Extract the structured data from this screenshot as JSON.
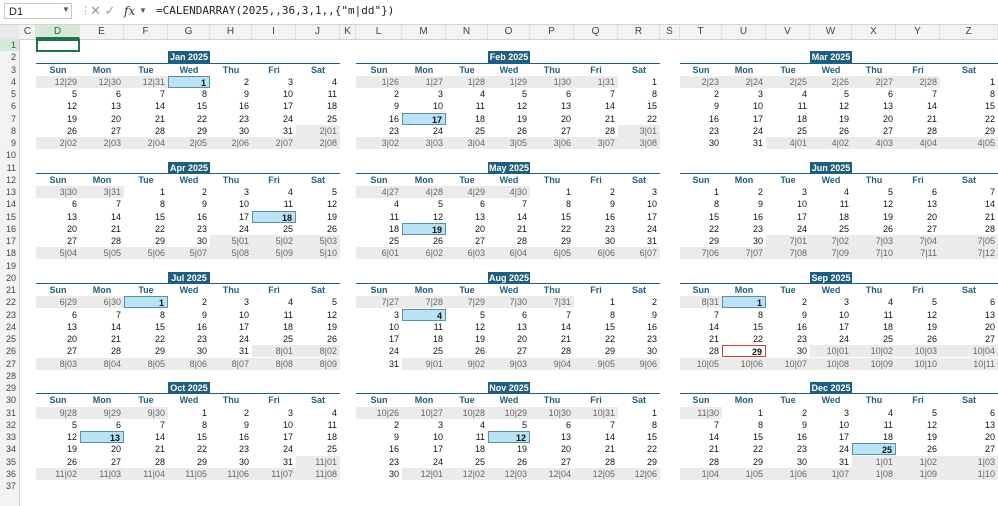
{
  "formula_bar": {
    "name_box": "D1",
    "fx": "fx",
    "cancel_glyph": "✕",
    "enter_glyph": "✓",
    "formula": "=CALENDARRAY(2025,,36,3,1,,{\"m|dd\"})"
  },
  "columns": [
    "C",
    "D",
    "E",
    "F",
    "G",
    "H",
    "I",
    "J",
    "K",
    "L",
    "M",
    "N",
    "O",
    "P",
    "Q",
    "R",
    "S",
    "T",
    "U",
    "V",
    "W",
    "X",
    "Y",
    "Z"
  ],
  "rows": [
    "1",
    "2",
    "3",
    "4",
    "5",
    "6",
    "7",
    "8",
    "9",
    "10",
    "11",
    "12",
    "13",
    "14",
    "15",
    "16",
    "17",
    "18",
    "19",
    "20",
    "21",
    "22",
    "23",
    "24",
    "25",
    "26",
    "27",
    "28",
    "29",
    "30",
    "31",
    "32",
    "33",
    "34",
    "35",
    "36",
    "37"
  ],
  "weekdays": [
    "Sun",
    "Mon",
    "Tue",
    "Wed",
    "Thu",
    "Fri",
    "Sat"
  ],
  "months": [
    {
      "title": "Jan 2025",
      "cells": [
        [
          "12|29",
          "12|30",
          "12|31",
          "1",
          "2",
          "3",
          "4"
        ],
        [
          "5",
          "6",
          "7",
          "8",
          "9",
          "10",
          "11"
        ],
        [
          "12",
          "13",
          "14",
          "15",
          "16",
          "17",
          "18"
        ],
        [
          "19",
          "20",
          "21",
          "22",
          "23",
          "24",
          "25"
        ],
        [
          "26",
          "27",
          "28",
          "29",
          "30",
          "31",
          "2|01"
        ],
        [
          "2|02",
          "2|03",
          "2|04",
          "2|05",
          "2|06",
          "2|07",
          "2|08"
        ]
      ]
    },
    {
      "title": "Feb 2025",
      "cells": [
        [
          "1|26",
          "1|27",
          "1|28",
          "1|29",
          "1|30",
          "1|31",
          "1"
        ],
        [
          "2",
          "3",
          "4",
          "5",
          "6",
          "7",
          "8"
        ],
        [
          "9",
          "10",
          "11",
          "12",
          "13",
          "14",
          "15"
        ],
        [
          "16",
          "17",
          "18",
          "19",
          "20",
          "21",
          "22"
        ],
        [
          "23",
          "24",
          "25",
          "26",
          "27",
          "28",
          "3|01"
        ],
        [
          "3|02",
          "3|03",
          "3|04",
          "3|05",
          "3|06",
          "3|07",
          "3|08"
        ]
      ]
    },
    {
      "title": "Mar 2025",
      "cells": [
        [
          "2|23",
          "2|24",
          "2|25",
          "2|26",
          "2|27",
          "2|28",
          "1"
        ],
        [
          "2",
          "3",
          "4",
          "5",
          "6",
          "7",
          "8"
        ],
        [
          "9",
          "10",
          "11",
          "12",
          "13",
          "14",
          "15"
        ],
        [
          "16",
          "17",
          "18",
          "19",
          "20",
          "21",
          "22"
        ],
        [
          "23",
          "24",
          "25",
          "26",
          "27",
          "28",
          "29"
        ],
        [
          "30",
          "31",
          "4|01",
          "4|02",
          "4|03",
          "4|04",
          "4|05"
        ]
      ]
    },
    {
      "title": "Apr 2025",
      "cells": [
        [
          "3|30",
          "3|31",
          "1",
          "2",
          "3",
          "4",
          "5"
        ],
        [
          "6",
          "7",
          "8",
          "9",
          "10",
          "11",
          "12"
        ],
        [
          "13",
          "14",
          "15",
          "16",
          "17",
          "18",
          "19"
        ],
        [
          "20",
          "21",
          "22",
          "23",
          "24",
          "25",
          "26"
        ],
        [
          "27",
          "28",
          "29",
          "30",
          "5|01",
          "5|02",
          "5|03"
        ],
        [
          "5|04",
          "5|05",
          "5|06",
          "5|07",
          "5|08",
          "5|09",
          "5|10"
        ]
      ]
    },
    {
      "title": "May 2025",
      "cells": [
        [
          "4|27",
          "4|28",
          "4|29",
          "4|30",
          "1",
          "2",
          "3"
        ],
        [
          "4",
          "5",
          "6",
          "7",
          "8",
          "9",
          "10"
        ],
        [
          "11",
          "12",
          "13",
          "14",
          "15",
          "16",
          "17"
        ],
        [
          "18",
          "19",
          "20",
          "21",
          "22",
          "23",
          "24"
        ],
        [
          "25",
          "26",
          "27",
          "28",
          "29",
          "30",
          "31"
        ],
        [
          "6|01",
          "6|02",
          "6|03",
          "6|04",
          "6|05",
          "6|06",
          "6|07"
        ]
      ]
    },
    {
      "title": "Jun 2025",
      "cells": [
        [
          "1",
          "2",
          "3",
          "4",
          "5",
          "6",
          "7"
        ],
        [
          "8",
          "9",
          "10",
          "11",
          "12",
          "13",
          "14"
        ],
        [
          "15",
          "16",
          "17",
          "18",
          "19",
          "20",
          "21"
        ],
        [
          "22",
          "23",
          "24",
          "25",
          "26",
          "27",
          "28"
        ],
        [
          "29",
          "30",
          "7|01",
          "7|02",
          "7|03",
          "7|04",
          "7|05"
        ],
        [
          "7|06",
          "7|07",
          "7|08",
          "7|09",
          "7|10",
          "7|11",
          "7|12"
        ]
      ]
    },
    {
      "title": "Jul 2025",
      "cells": [
        [
          "6|29",
          "6|30",
          "1",
          "2",
          "3",
          "4",
          "5"
        ],
        [
          "6",
          "7",
          "8",
          "9",
          "10",
          "11",
          "12"
        ],
        [
          "13",
          "14",
          "15",
          "16",
          "17",
          "18",
          "19"
        ],
        [
          "20",
          "21",
          "22",
          "23",
          "24",
          "25",
          "26"
        ],
        [
          "27",
          "28",
          "29",
          "30",
          "31",
          "8|01",
          "8|02"
        ],
        [
          "8|03",
          "8|04",
          "8|05",
          "8|06",
          "8|07",
          "8|08",
          "8|09"
        ]
      ]
    },
    {
      "title": "Aug 2025",
      "cells": [
        [
          "7|27",
          "7|28",
          "7|29",
          "7|30",
          "7|31",
          "1",
          "2"
        ],
        [
          "3",
          "4",
          "5",
          "6",
          "7",
          "8",
          "9"
        ],
        [
          "10",
          "11",
          "12",
          "13",
          "14",
          "15",
          "16"
        ],
        [
          "17",
          "18",
          "19",
          "20",
          "21",
          "22",
          "23"
        ],
        [
          "24",
          "25",
          "26",
          "27",
          "28",
          "29",
          "30"
        ],
        [
          "31",
          "9|01",
          "9|02",
          "9|03",
          "9|04",
          "9|05",
          "9|06"
        ]
      ]
    },
    {
      "title": "Sep 2025",
      "cells": [
        [
          "8|31",
          "1",
          "2",
          "3",
          "4",
          "5",
          "6"
        ],
        [
          "7",
          "8",
          "9",
          "10",
          "11",
          "12",
          "13"
        ],
        [
          "14",
          "15",
          "16",
          "17",
          "18",
          "19",
          "20"
        ],
        [
          "21",
          "22",
          "23",
          "24",
          "25",
          "26",
          "27"
        ],
        [
          "28",
          "29",
          "30",
          "10|01",
          "10|02",
          "10|03",
          "10|04"
        ],
        [
          "10|05",
          "10|06",
          "10|07",
          "10|08",
          "10|09",
          "10|10",
          "10|11"
        ]
      ]
    },
    {
      "title": "Oct 2025",
      "cells": [
        [
          "9|28",
          "9|29",
          "9|30",
          "1",
          "2",
          "3",
          "4"
        ],
        [
          "5",
          "6",
          "7",
          "8",
          "9",
          "10",
          "11"
        ],
        [
          "12",
          "13",
          "14",
          "15",
          "16",
          "17",
          "18"
        ],
        [
          "19",
          "20",
          "21",
          "22",
          "23",
          "24",
          "25"
        ],
        [
          "26",
          "27",
          "28",
          "29",
          "30",
          "31",
          "11|01"
        ],
        [
          "11|02",
          "11|03",
          "11|04",
          "11|05",
          "11|06",
          "11|07",
          "11|08"
        ]
      ]
    },
    {
      "title": "Nov 2025",
      "cells": [
        [
          "10|26",
          "10|27",
          "10|28",
          "10|29",
          "10|30",
          "10|31",
          "1"
        ],
        [
          "2",
          "3",
          "4",
          "5",
          "6",
          "7",
          "8"
        ],
        [
          "9",
          "10",
          "11",
          "12",
          "13",
          "14",
          "15"
        ],
        [
          "16",
          "17",
          "18",
          "19",
          "20",
          "21",
          "22"
        ],
        [
          "23",
          "24",
          "25",
          "26",
          "27",
          "28",
          "29"
        ],
        [
          "30",
          "12|01",
          "12|02",
          "12|03",
          "12|04",
          "12|05",
          "12|06"
        ]
      ]
    },
    {
      "title": "Dec 2025",
      "cells": [
        [
          "11|30",
          "1",
          "2",
          "3",
          "4",
          "5",
          "6"
        ],
        [
          "7",
          "8",
          "9",
          "10",
          "11",
          "12",
          "13"
        ],
        [
          "14",
          "15",
          "16",
          "17",
          "18",
          "19",
          "20"
        ],
        [
          "21",
          "22",
          "23",
          "24",
          "25",
          "26",
          "27"
        ],
        [
          "28",
          "29",
          "30",
          "31",
          "1|01",
          "1|02",
          "1|03"
        ],
        [
          "1|04",
          "1|05",
          "1|06",
          "1|07",
          "1|08",
          "1|09",
          "1|10"
        ]
      ]
    }
  ],
  "highlights": [
    {
      "month": 0,
      "week": 0,
      "day": 3
    },
    {
      "month": 1,
      "week": 3,
      "day": 1
    },
    {
      "month": 3,
      "week": 2,
      "day": 5
    },
    {
      "month": 4,
      "week": 3,
      "day": 1
    },
    {
      "month": 6,
      "week": 0,
      "day": 2
    },
    {
      "month": 7,
      "week": 1,
      "day": 1
    },
    {
      "month": 8,
      "week": 0,
      "day": 1
    },
    {
      "month": 9,
      "week": 2,
      "day": 1
    },
    {
      "month": 10,
      "week": 2,
      "day": 3
    },
    {
      "month": 11,
      "week": 3,
      "day": 4
    }
  ],
  "today_marker": {
    "month": 8,
    "week": 4,
    "day": 1
  },
  "colors": {
    "accent": "#1f5f7d",
    "highlight": "#b9e3f3",
    "other_month": "#ebebeb",
    "today": "#d73a3a",
    "excel_green": "#217346"
  }
}
